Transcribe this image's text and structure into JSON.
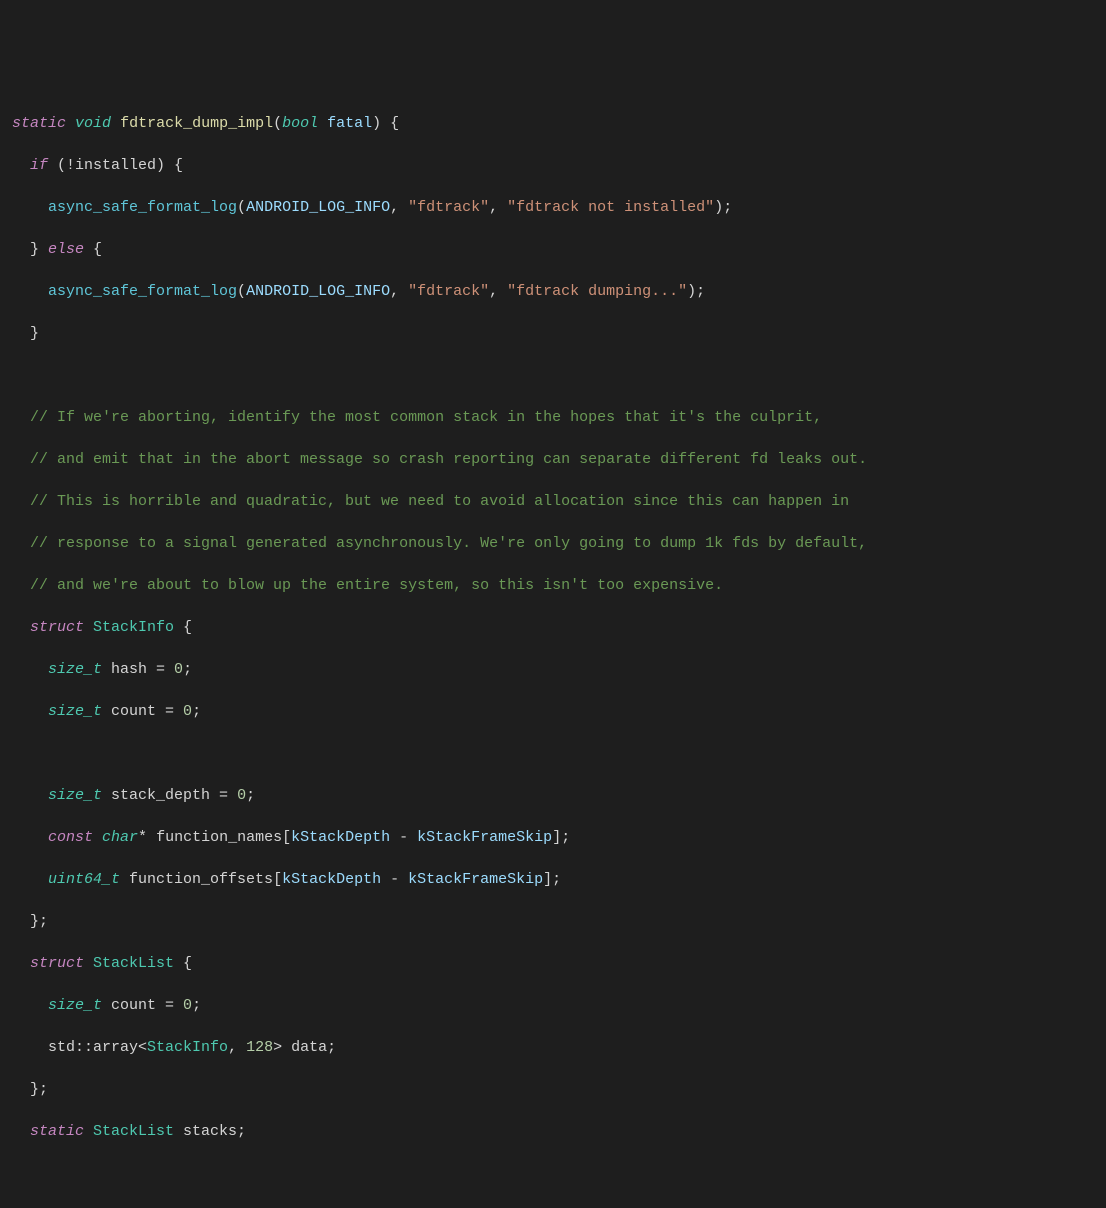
{
  "code": {
    "l1": {
      "static": "static",
      "void": "void",
      "fn": "fdtrack_dump_impl",
      "lp": "(",
      "bool": "bool",
      "param": " fatal",
      "rp": ") {"
    },
    "l2": {
      "indent": "  ",
      "if": "if",
      "cond": " (!installed) {"
    },
    "l3": {
      "indent": "    ",
      "fn": "async_safe_format_log",
      "lp": "(",
      "const": "ANDROID_LOG_INFO",
      "c1": ", ",
      "s1": "\"fdtrack\"",
      "c2": ", ",
      "s2": "\"fdtrack not installed\"",
      "rp": ");"
    },
    "l4": {
      "indent": "  ",
      "close": "} ",
      "else": "else",
      "open": " {"
    },
    "l5": {
      "indent": "    ",
      "fn": "async_safe_format_log",
      "lp": "(",
      "const": "ANDROID_LOG_INFO",
      "c1": ", ",
      "s1": "\"fdtrack\"",
      "c2": ", ",
      "s2": "\"fdtrack dumping...\"",
      "rp": ");"
    },
    "l6": {
      "indent": "  ",
      "close": "}"
    },
    "l7": "",
    "l8": "  // If we're aborting, identify the most common stack in the hopes that it's the culprit,",
    "l9": "  // and emit that in the abort message so crash reporting can separate different fd leaks out.",
    "l10": "  // This is horrible and quadratic, but we need to avoid allocation since this can happen in",
    "l11": "  // response to a signal generated asynchronously. We're only going to dump 1k fds by default,",
    "l12": "  // and we're about to blow up the entire system, so this isn't too expensive.",
    "l13": {
      "indent": "  ",
      "struct": "struct",
      "name": " StackInfo",
      "open": " {"
    },
    "l14": {
      "indent": "    ",
      "type": "size_t",
      "member": " hash = ",
      "num": "0",
      "semi": ";"
    },
    "l15": {
      "indent": "    ",
      "type": "size_t",
      "member": " count = ",
      "num": "0",
      "semi": ";"
    },
    "l16": "",
    "l17": {
      "indent": "    ",
      "type": "size_t",
      "member": " stack_depth = ",
      "num": "0",
      "semi": ";"
    },
    "l18": {
      "indent": "    ",
      "const": "const",
      "char": " char",
      "ptr": "* ",
      "member": "function_names",
      "lb": "[",
      "k1": "kStackDepth",
      "minus": " - ",
      "k2": "kStackFrameSkip",
      "rb": "];"
    },
    "l19": {
      "indent": "    ",
      "type": "uint64_t",
      "member": " function_offsets",
      "lb": "[",
      "k1": "kStackDepth",
      "minus": " - ",
      "k2": "kStackFrameSkip",
      "rb": "];"
    },
    "l20": {
      "indent": "  ",
      "close": "};"
    },
    "l21": {
      "indent": "  ",
      "struct": "struct",
      "name": " StackList",
      "open": " {"
    },
    "l22": {
      "indent": "    ",
      "type": "size_t",
      "member": " count = ",
      "num": "0",
      "semi": ";"
    },
    "l23": {
      "indent": "    ",
      "ns": "std::array<",
      "tname": "StackInfo",
      "c": ", ",
      "num": "128",
      "gt": "> data;"
    },
    "l24": {
      "indent": "  ",
      "close": "};"
    },
    "l25": {
      "indent": "  ",
      "static": "static",
      "name": " StackList",
      "var": " stacks;"
    }
  }
}
